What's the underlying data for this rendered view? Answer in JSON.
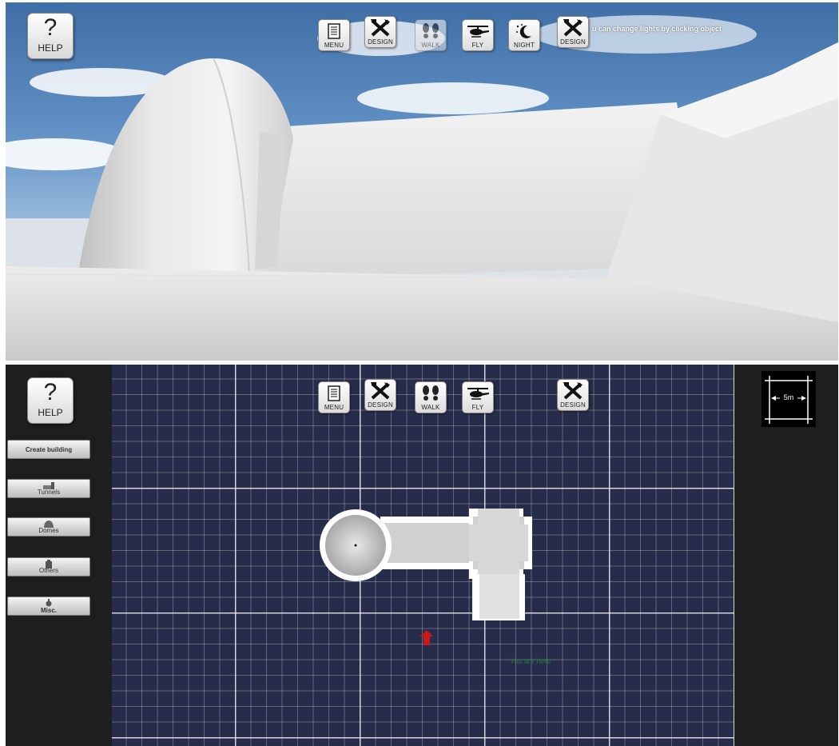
{
  "top_view": {
    "help": {
      "symbol": "?",
      "label": "HELP"
    },
    "toolbar": [
      {
        "id": "menu",
        "label": "MENU",
        "icon": "menu-document-icon",
        "dim": false
      },
      {
        "id": "design",
        "label": "DESIGN",
        "icon": "tools-crossed-icon",
        "dim": false
      },
      {
        "id": "walk",
        "label": "WALK",
        "icon": "footprints-icon",
        "dim": true
      },
      {
        "id": "fly",
        "label": "FLY",
        "icon": "helicopter-icon",
        "dim": false
      },
      {
        "id": "night",
        "label": "NIGHT",
        "icon": "moon-stars-icon",
        "dim": false
      },
      {
        "id": "design2",
        "label": "DESIGN",
        "icon": "tools-crossed-icon",
        "dim": false
      }
    ],
    "hint": "u can change lights by clicking object"
  },
  "map_view": {
    "help": {
      "symbol": "?",
      "label": "HELP"
    },
    "toolbar": [
      {
        "id": "menu",
        "label": "MENU",
        "icon": "menu-document-icon"
      },
      {
        "id": "design",
        "label": "DESIGN",
        "icon": "tools-crossed-icon"
      },
      {
        "id": "walk",
        "label": "WALK",
        "icon": "footprints-icon"
      },
      {
        "id": "fly",
        "label": "FLY",
        "icon": "helicopter-icon"
      },
      {
        "id": "design2",
        "label": "DESIGN",
        "icon": "tools-crossed-icon"
      }
    ],
    "sidebar": {
      "create_building": "Create building",
      "tunnels": "Tunnels",
      "domes": "Domes",
      "others": "Others",
      "misc": "Misc."
    },
    "scale_label": "5m",
    "you_are_here": "You are here",
    "colors": {
      "grid_bg": "#272c4a",
      "marker": "#cc1a1a",
      "you_are_here_text": "#1e7d3a"
    }
  }
}
